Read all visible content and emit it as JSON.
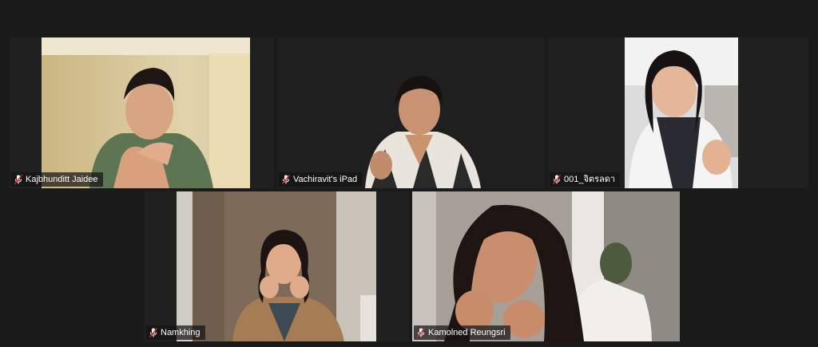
{
  "participants": [
    {
      "name": "Kajbhunditt Jaidee",
      "mic_icon": "mic-muted-icon",
      "bg": "#d9c69a"
    },
    {
      "name": "Vachiravit's iPad",
      "mic_icon": "mic-muted-icon",
      "bg": "#1e1e1e"
    },
    {
      "name": "001_จิตรลดา",
      "mic_icon": "mic-muted-icon",
      "bg": "#e8e8e8"
    },
    {
      "name": "Namkhing",
      "mic_icon": "mic-muted-icon",
      "bg": "#8c7560"
    },
    {
      "name": "Kamolned Reungsri",
      "mic_icon": "mic-muted-icon",
      "bg": "#9a948c"
    }
  ]
}
